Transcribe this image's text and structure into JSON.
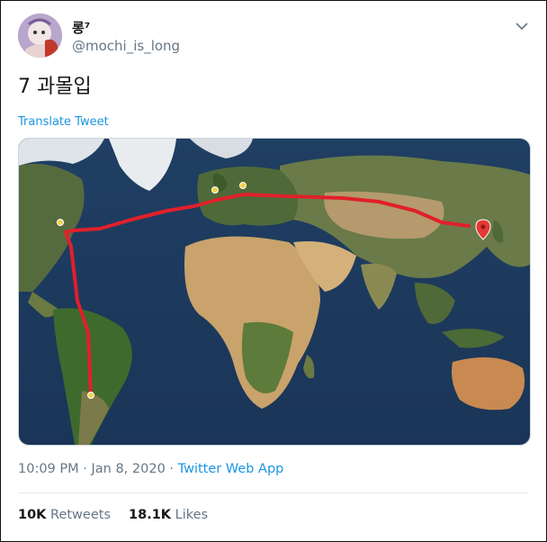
{
  "user": {
    "display_name": "롱⁷",
    "handle": "@mochi_is_long"
  },
  "tweet": {
    "text": "7 과몰입",
    "translate_label": "Translate Tweet"
  },
  "meta": {
    "time": "10:09 PM",
    "separator1": " · ",
    "date": "Jan 8, 2020",
    "separator2": " · ",
    "source": "Twitter Web App"
  },
  "stats": {
    "retweets_count": "10K",
    "retweets_label": "Retweets",
    "likes_count": "18.1K",
    "likes_label": "Likes"
  },
  "icons": {
    "menu": "chevron-down-icon",
    "pins": "map-pin-icon",
    "destination": "map-marker-icon"
  },
  "colors": {
    "link": "#1b95e0",
    "route": "#e0202b",
    "ocean": "#1c3a5c"
  }
}
